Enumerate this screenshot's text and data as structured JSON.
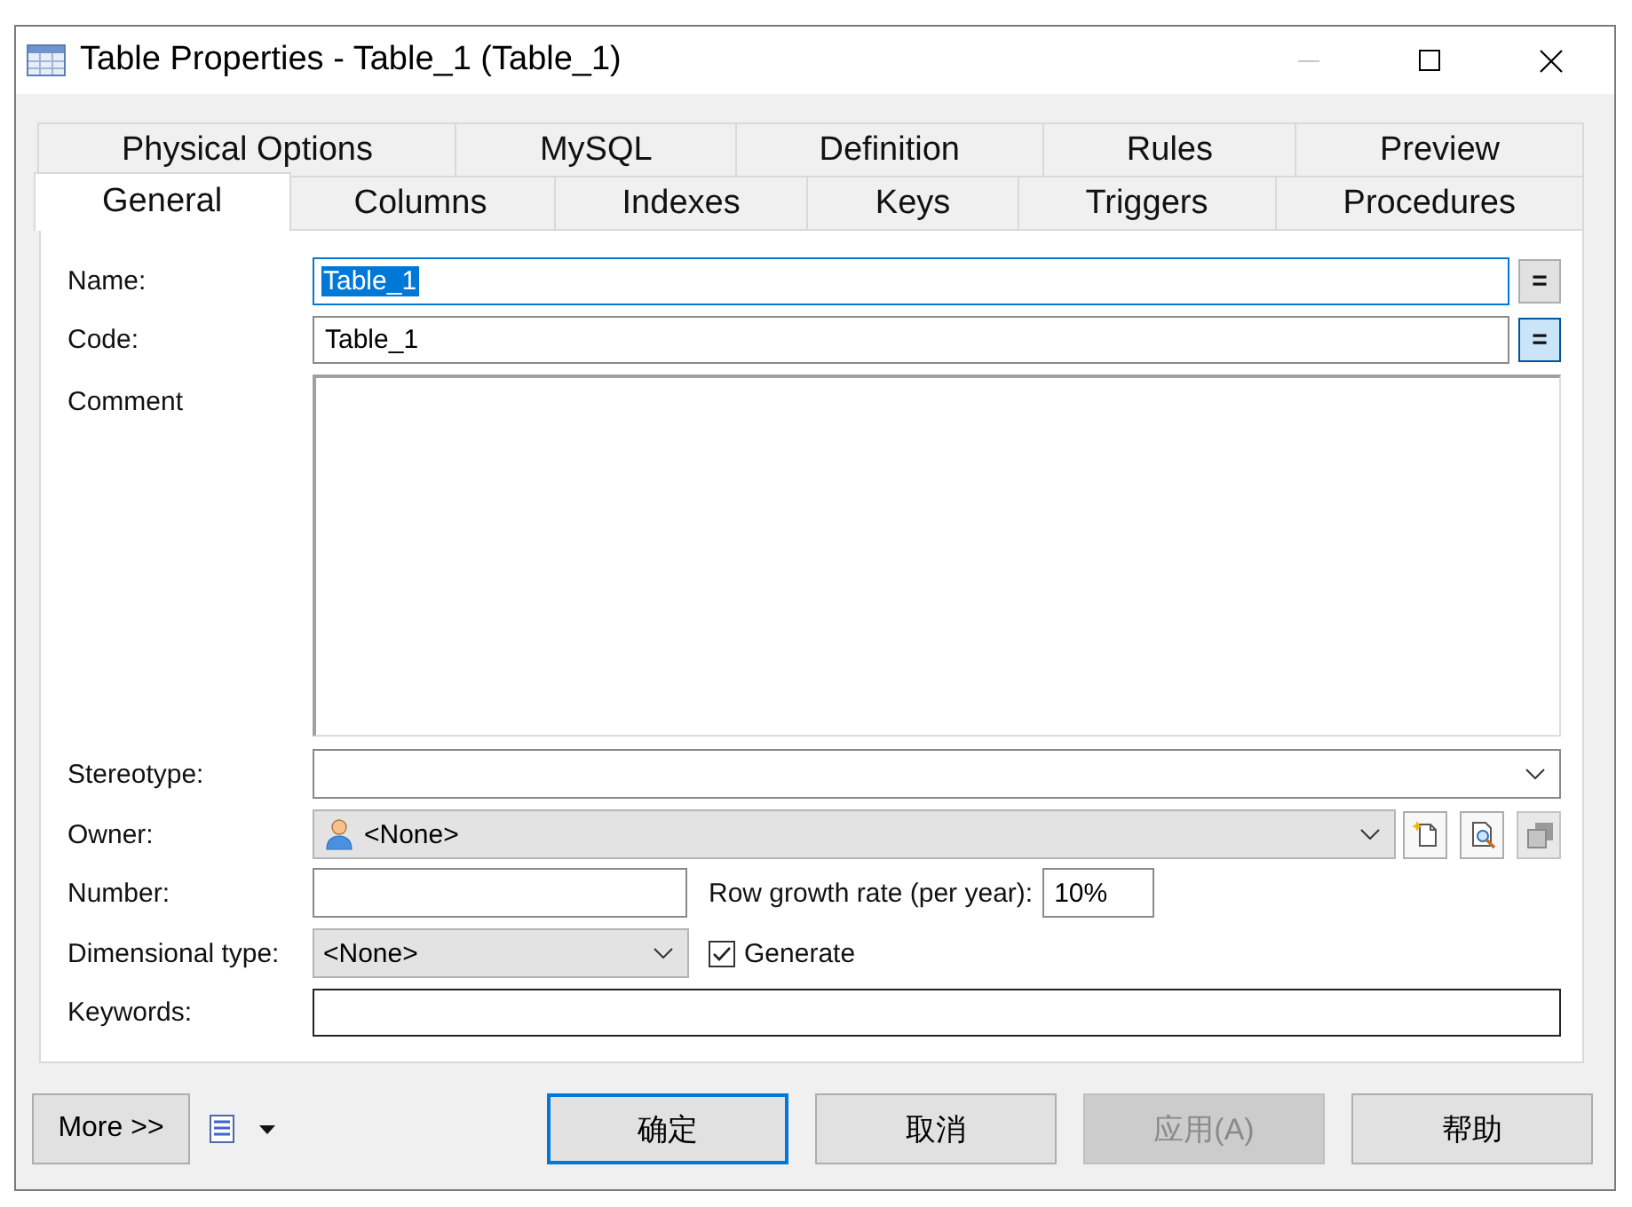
{
  "window": {
    "title": "Table Properties - Table_1 (Table_1)",
    "minimize_disabled": true
  },
  "tab_rows": [
    [
      {
        "label": "Physical Options",
        "selected": false
      },
      {
        "label": "MySQL",
        "selected": false
      },
      {
        "label": "Definition",
        "selected": false
      },
      {
        "label": "Rules",
        "selected": false
      },
      {
        "label": "Preview",
        "selected": false
      }
    ],
    [
      {
        "label": "General",
        "selected": true
      },
      {
        "label": "Columns",
        "selected": false
      },
      {
        "label": "Indexes",
        "selected": false
      },
      {
        "label": "Keys",
        "selected": false
      },
      {
        "label": "Triggers",
        "selected": false
      },
      {
        "label": "Procedures",
        "selected": false
      }
    ]
  ],
  "general": {
    "name": {
      "label": "Name:",
      "value": "Table_1",
      "focused": true,
      "value_selected": true,
      "sync_button": {
        "label": "=",
        "pressed": false
      }
    },
    "code": {
      "label": "Code:",
      "value": "Table_1",
      "focused": false,
      "value_selected": false,
      "sync_button": {
        "label": "=",
        "pressed": true
      }
    },
    "comment": {
      "label": "Comment"
    },
    "stereotype": {
      "label": "Stereotype:",
      "editable": true
    },
    "owner": {
      "label": "Owner:",
      "value": "<None>",
      "editable": false,
      "tool_buttons": [
        {
          "kind": "new",
          "disabled": false
        },
        {
          "kind": "browse",
          "disabled": false
        },
        {
          "kind": "properties",
          "disabled": true
        }
      ]
    },
    "number": {
      "label": "Number:"
    },
    "row_growth_rate": {
      "label": "Row growth rate (per year):",
      "value": "10%"
    },
    "dimensional_type": {
      "label": "Dimensional type:",
      "value": "<None>",
      "editable": false
    },
    "generate": {
      "label": "Generate",
      "checked": true
    },
    "keywords": {
      "label": "Keywords:"
    }
  },
  "footer": {
    "more_button": "More >>",
    "buttons": [
      {
        "label": "确定",
        "default": true,
        "disabled": false
      },
      {
        "label": "取消",
        "default": false,
        "disabled": false
      },
      {
        "label": "应用(A)",
        "default": false,
        "disabled": true
      },
      {
        "label": "帮助",
        "default": false,
        "disabled": false
      }
    ]
  }
}
